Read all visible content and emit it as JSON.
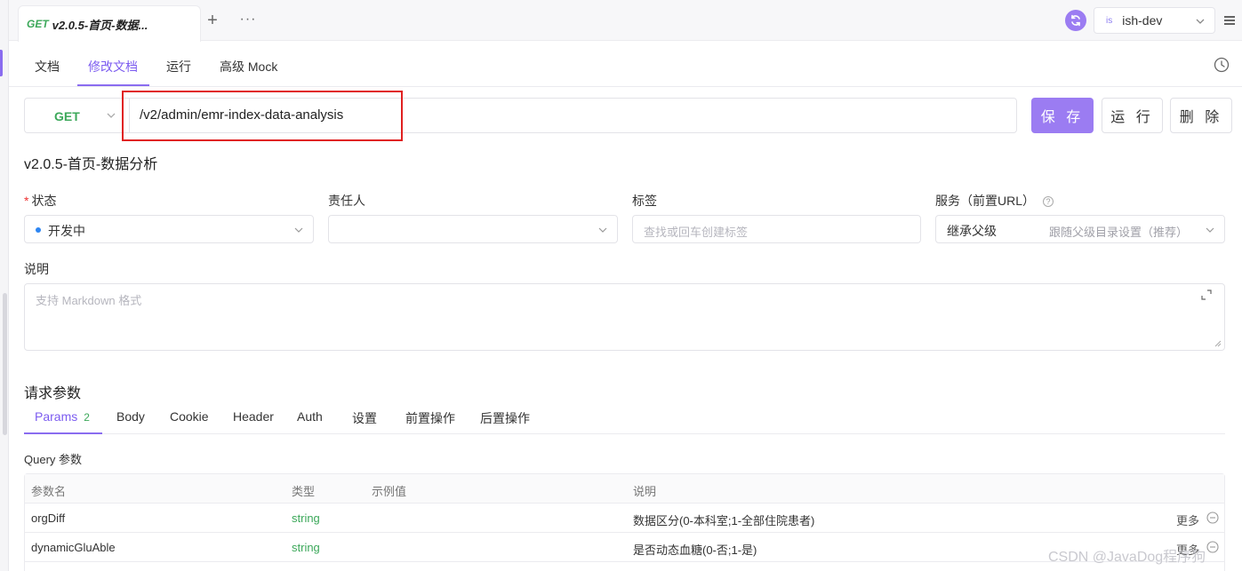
{
  "tab": {
    "method": "GET",
    "title": "v2.0.5-首页-数据..."
  },
  "topbar": {
    "env_badge": "is",
    "env_name": "ish-dev"
  },
  "subtabs": [
    "文档",
    "修改文档",
    "运行",
    "高级 Mock"
  ],
  "request": {
    "method": "GET",
    "url": "/v2/admin/emr-index-data-analysis",
    "save_label": "保 存",
    "run_label": "运 行",
    "delete_label": "删 除"
  },
  "api_name": "v2.0.5-首页-数据分析",
  "fields": {
    "status_label": "状态",
    "status_value": "开发中",
    "owner_label": "责任人",
    "tag_label": "标签",
    "tag_placeholder": "查找或回车创建标签",
    "service_label": "服务（前置URL）",
    "service_value": "继承父级",
    "service_hint": "跟随父级目录设置（推荐）"
  },
  "description": {
    "label": "说明",
    "placeholder": "支持 Markdown 格式"
  },
  "params_section": {
    "title": "请求参数",
    "tabs": [
      "Params",
      "Body",
      "Cookie",
      "Header",
      "Auth",
      "设置",
      "前置操作",
      "后置操作"
    ],
    "params_count": "2",
    "query_label": "Query 参数",
    "columns": [
      "参数名",
      "类型",
      "示例值",
      "说明"
    ],
    "rows": [
      {
        "name": "orgDiff",
        "type": "string",
        "example": "",
        "desc": "数据区分(0-本科室;1-全部住院患者)",
        "more": "更多"
      },
      {
        "name": "dynamicGluAble",
        "type": "string",
        "example": "",
        "desc": "是否动态血糖(0-否;1-是)",
        "more": "更多"
      }
    ]
  },
  "watermark": "CSDN @JavaDog程序狗",
  "colors": {
    "accent": "#9b7cf2",
    "method_get": "#3ca85a",
    "highlight_box": "#e02020"
  }
}
